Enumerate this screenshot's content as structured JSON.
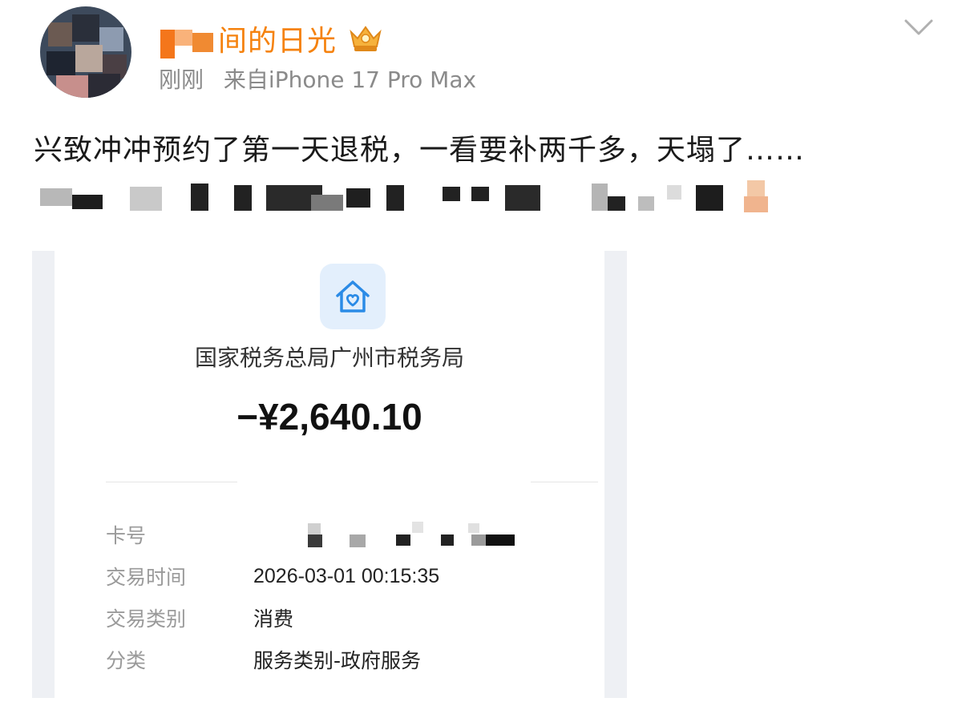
{
  "post": {
    "username": "间的日光",
    "time": "刚刚",
    "source": "来自iPhone 17 Pro Max",
    "text": "兴致冲冲预约了第一天退税，一看要补两千多，天塌了……"
  },
  "receipt": {
    "merchant": "国家税务总局广州市税务局",
    "amount": "−¥2,640.10",
    "rows": [
      {
        "label": "卡号",
        "value": ""
      },
      {
        "label": "交易时间",
        "value": "2026-03-01 00:15:35"
      },
      {
        "label": "交易类别",
        "value": "消费"
      },
      {
        "label": "分类",
        "value": "服务类别-政府服务"
      }
    ]
  },
  "icons": {
    "vip": "crown-badge-icon",
    "menu": "chevron-down-icon",
    "app": "house-heart-icon"
  },
  "colors": {
    "username": "#f5820e",
    "app_icon_bg": "#e3effc",
    "app_icon_fg": "#2b8be6"
  }
}
